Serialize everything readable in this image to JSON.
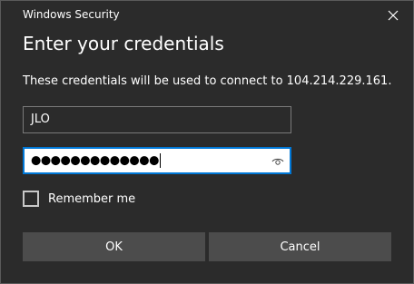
{
  "window": {
    "title": "Windows Security"
  },
  "dialog": {
    "heading": "Enter your credentials",
    "description": "These credentials will be used to connect to 104.214.229.161."
  },
  "form": {
    "username_value": "JLO",
    "password_masked": "●●●●●●●●●●●●●",
    "remember_label": "Remember me",
    "remember_checked": false
  },
  "buttons": {
    "ok_label": "OK",
    "cancel_label": "Cancel"
  },
  "icons": {
    "close": "close-icon",
    "reveal": "eye-icon"
  },
  "colors": {
    "background": "#2b2b2b",
    "accent": "#0078d7",
    "button": "#4c4c4c"
  }
}
